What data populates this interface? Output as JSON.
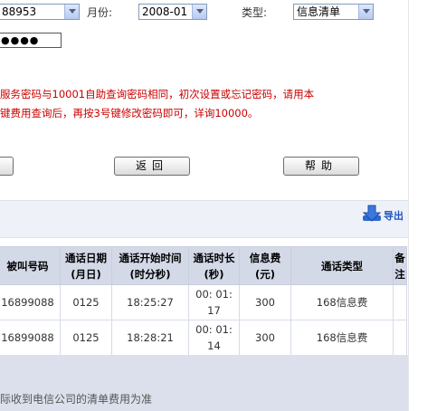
{
  "filters": {
    "phone_select": "88953",
    "month_label": "月份:",
    "month_select": "2008-01",
    "type_label": "类型:",
    "type_select": "信息清单"
  },
  "password_mask": "●●●●",
  "notice": {
    "line1": "服务密码与10001自助查询密码相同，初次设置或忘记密码，请用本",
    "line2": "键费用查询后，再按3号键修改密码即可，详询10000。"
  },
  "buttons": {
    "back": "返回",
    "help": "帮助"
  },
  "export_label": "导出",
  "table": {
    "headers": [
      [
        "被叫号码"
      ],
      [
        "通话日期",
        "(月日)"
      ],
      [
        "通话开始时间",
        "(时分秒)"
      ],
      [
        "通话时长",
        "(秒)"
      ],
      [
        "信息费",
        "(元)"
      ],
      [
        "通话类型"
      ],
      [
        "备",
        "注"
      ]
    ],
    "rows": [
      {
        "callee": "16899088",
        "date": "0125",
        "start": "18:25:27",
        "dur1": "00: 01:",
        "dur2": "17",
        "fee": "300",
        "type": "168信息费",
        "note": ""
      },
      {
        "callee": "16899088",
        "date": "0125",
        "start": "18:28:21",
        "dur1": "00: 01:",
        "dur2": "14",
        "fee": "300",
        "type": "168信息费",
        "note": ""
      }
    ]
  },
  "footer_text": "际收到电信公司的清单费用为准",
  "colors": {
    "notice_red": "#cc0000",
    "header_bg": "#d4d9e8",
    "panel_bg": "#dce0ec"
  }
}
